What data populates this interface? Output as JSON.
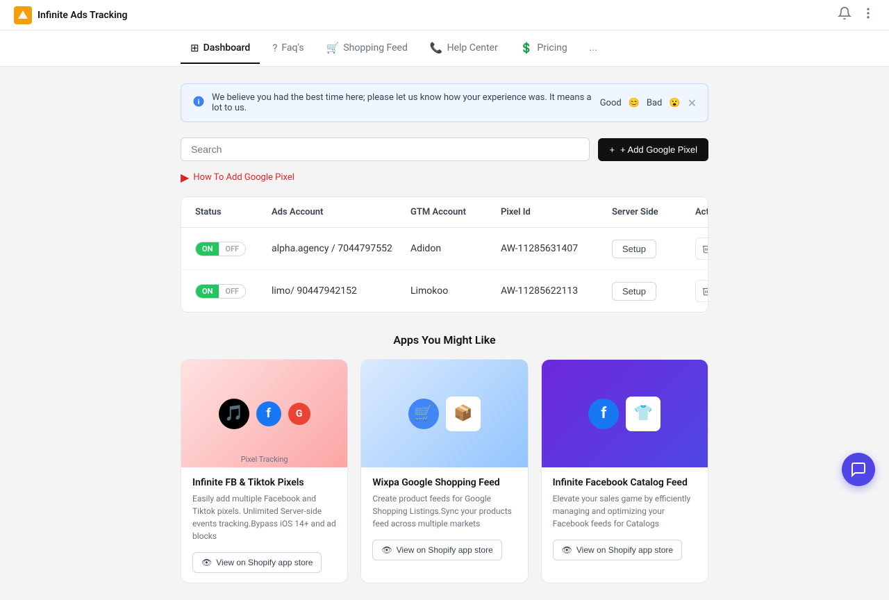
{
  "app": {
    "name": "Infinite Ads Tracking",
    "logo_letter": "A"
  },
  "topbar": {
    "bell_icon": "🔔",
    "more_icon": "⋯"
  },
  "nav": {
    "tabs": [
      {
        "id": "dashboard",
        "label": "Dashboard",
        "icon": "▦",
        "active": true
      },
      {
        "id": "faqs",
        "label": "Faq's",
        "icon": "❓",
        "active": false
      },
      {
        "id": "shopping-feed",
        "label": "Shopping Feed",
        "icon": "🛒",
        "active": false
      },
      {
        "id": "help-center",
        "label": "Help Center",
        "icon": "📞",
        "active": false
      },
      {
        "id": "pricing",
        "label": "Pricing",
        "icon": "💰",
        "active": false
      },
      {
        "id": "more",
        "label": "...",
        "icon": "",
        "active": false
      }
    ]
  },
  "notice": {
    "message": "We believe you had the best time here; please let us know how your experience was. It means a lot to us.",
    "good_label": "Good",
    "bad_label": "Bad",
    "good_emoji": "😊",
    "bad_emoji": "😮"
  },
  "search": {
    "placeholder": "Search"
  },
  "add_pixel_button": "+ Add Google Pixel",
  "how_to_link": "How To Add Google Pixel",
  "table": {
    "headers": [
      "Status",
      "Ads Account",
      "GTM Account",
      "Pixel Id",
      "Server Side",
      "Actions"
    ],
    "rows": [
      {
        "status_on": "ON",
        "status_off": "OFF",
        "ads_account": "alpha.agency / 7044797552",
        "gtm_account": "Adidon",
        "pixel_id": "AW-11285631407",
        "server_side_label": "Setup"
      },
      {
        "status_on": "ON",
        "status_off": "OFF",
        "ads_account": "limo/ 90447942152",
        "gtm_account": "Limokoo",
        "pixel_id": "AW-11285622113",
        "server_side_label": "Setup"
      }
    ]
  },
  "apps_section": {
    "title": "Apps You Might Like",
    "apps": [
      {
        "name": "Infinite FB & Tiktok Pixels",
        "description": "Easily add multiple Facebook and Tiktok pixels. Unlimited Server-side events tracking.Bypass iOS 14+ and ad blocks",
        "button": "View on Shopify app store",
        "bg": "red-bg"
      },
      {
        "name": "Wixpa Google Shopping Feed",
        "description": "Create product feeds for Google Shopping Listings.Sync your products feed across multiple markets",
        "button": "View on Shopify app store",
        "bg": "blue-bg"
      },
      {
        "name": "Infinite Facebook Catalog Feed",
        "description": "Elevate your sales game by efficiently managing and optimizing your Facebook feeds for Catalogs",
        "button": "View on Shopify app store",
        "bg": "purple-bg"
      }
    ]
  },
  "chat_icon": "💬"
}
